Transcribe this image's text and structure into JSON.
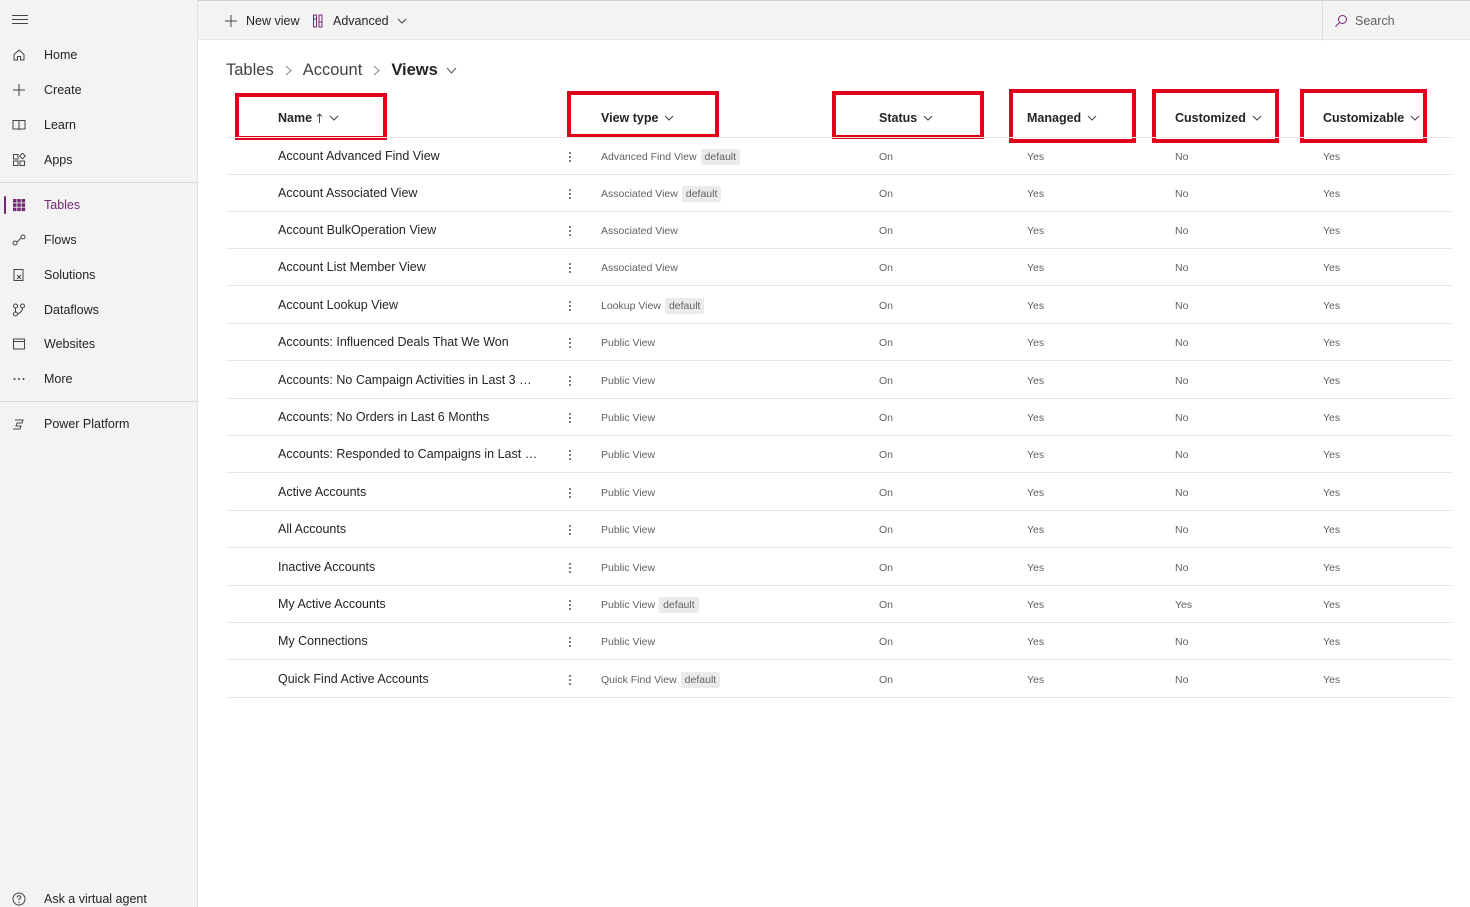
{
  "sidebar": {
    "items": [
      {
        "label": "Home",
        "icon": "home-icon"
      },
      {
        "label": "Create",
        "icon": "plus-icon"
      },
      {
        "label": "Learn",
        "icon": "book-icon"
      },
      {
        "label": "Apps",
        "icon": "apps-icon"
      },
      {
        "label": "Tables",
        "icon": "table-grid-icon",
        "active": true
      },
      {
        "label": "Flows",
        "icon": "flow-icon"
      },
      {
        "label": "Solutions",
        "icon": "solutions-icon"
      },
      {
        "label": "Dataflows",
        "icon": "dataflow-icon"
      },
      {
        "label": "Websites",
        "icon": "website-icon"
      },
      {
        "label": "More",
        "icon": "ellipsis-icon"
      },
      {
        "label": "Power Platform",
        "icon": "power-platform-icon"
      }
    ],
    "virtual_agent": "Ask a virtual agent"
  },
  "toolbar": {
    "new_view": "New view",
    "advanced": "Advanced",
    "search_label": "Search"
  },
  "breadcrumb": {
    "tables": "Tables",
    "account": "Account",
    "views": "Views"
  },
  "table": {
    "columns": {
      "name": "Name",
      "view_type": "View type",
      "status": "Status",
      "managed": "Managed",
      "customized": "Customized",
      "customizable": "Customizable"
    },
    "rows": [
      {
        "name": "Account Advanced Find View",
        "type": "Advanced Find View",
        "badge": "default",
        "status": "On",
        "managed": "Yes",
        "customized": "No",
        "customizable": "Yes"
      },
      {
        "name": "Account Associated View",
        "type": "Associated View",
        "badge": "default",
        "status": "On",
        "managed": "Yes",
        "customized": "No",
        "customizable": "Yes"
      },
      {
        "name": "Account BulkOperation View",
        "type": "Associated View",
        "badge": "",
        "status": "On",
        "managed": "Yes",
        "customized": "No",
        "customizable": "Yes"
      },
      {
        "name": "Account List Member View",
        "type": "Associated View",
        "badge": "",
        "status": "On",
        "managed": "Yes",
        "customized": "No",
        "customizable": "Yes"
      },
      {
        "name": "Account Lookup View",
        "type": "Lookup View",
        "badge": "default",
        "status": "On",
        "managed": "Yes",
        "customized": "No",
        "customizable": "Yes"
      },
      {
        "name": "Accounts: Influenced Deals That We Won",
        "type": "Public View",
        "badge": "",
        "status": "On",
        "managed": "Yes",
        "customized": "No",
        "customizable": "Yes"
      },
      {
        "name": "Accounts: No Campaign Activities in Last 3 Mo...",
        "type": "Public View",
        "badge": "",
        "status": "On",
        "managed": "Yes",
        "customized": "No",
        "customizable": "Yes"
      },
      {
        "name": "Accounts: No Orders in Last 6 Months",
        "type": "Public View",
        "badge": "",
        "status": "On",
        "managed": "Yes",
        "customized": "No",
        "customizable": "Yes"
      },
      {
        "name": "Accounts: Responded to Campaigns in Last 6 ...",
        "type": "Public View",
        "badge": "",
        "status": "On",
        "managed": "Yes",
        "customized": "No",
        "customizable": "Yes"
      },
      {
        "name": "Active Accounts",
        "type": "Public View",
        "badge": "",
        "status": "On",
        "managed": "Yes",
        "customized": "No",
        "customizable": "Yes"
      },
      {
        "name": "All Accounts",
        "type": "Public View",
        "badge": "",
        "status": "On",
        "managed": "Yes",
        "customized": "No",
        "customizable": "Yes"
      },
      {
        "name": "Inactive Accounts",
        "type": "Public View",
        "badge": "",
        "status": "On",
        "managed": "Yes",
        "customized": "No",
        "customizable": "Yes"
      },
      {
        "name": "My Active Accounts",
        "type": "Public View",
        "badge": "default",
        "status": "On",
        "managed": "Yes",
        "customized": "Yes",
        "customizable": "Yes"
      },
      {
        "name": "My Connections",
        "type": "Public View",
        "badge": "",
        "status": "On",
        "managed": "Yes",
        "customized": "No",
        "customizable": "Yes"
      },
      {
        "name": "Quick Find Active Accounts",
        "type": "Quick Find View",
        "badge": "default",
        "status": "On",
        "managed": "Yes",
        "customized": "No",
        "customizable": "Yes"
      }
    ]
  },
  "colors": {
    "accent": "#742774",
    "highlight_box": "#e3001b"
  }
}
